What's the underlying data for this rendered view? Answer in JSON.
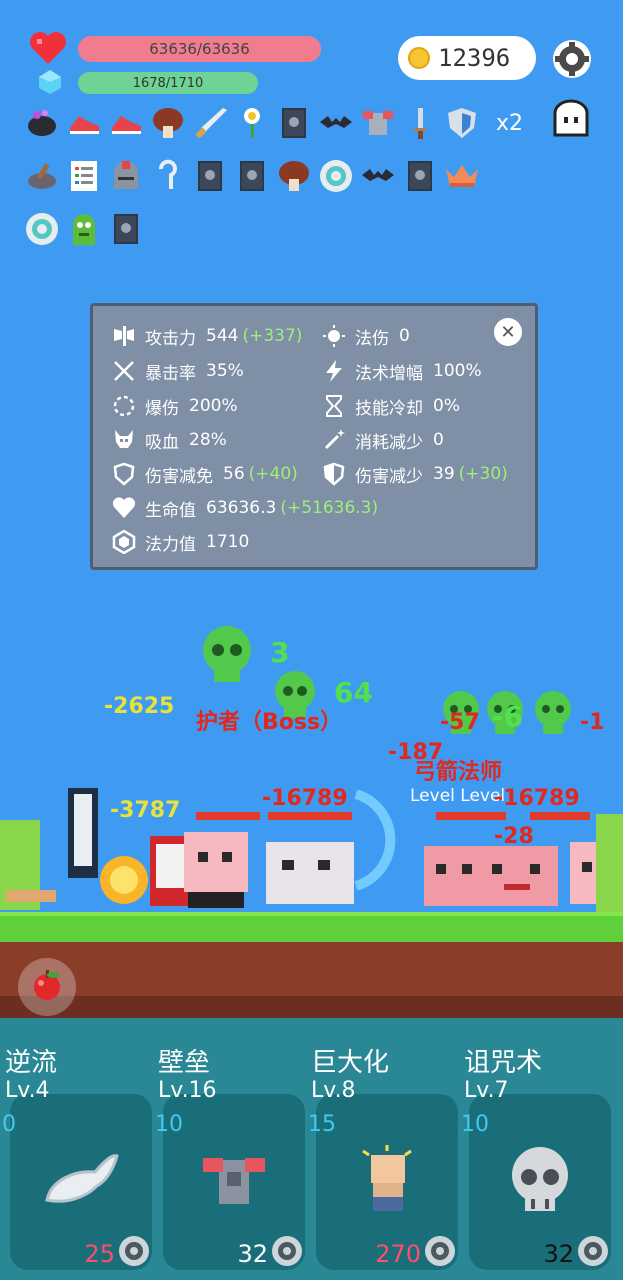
{
  "hud": {
    "hp": "63636/63636",
    "mp": "1678/1710",
    "coins": "12396",
    "multiplier": "x2"
  },
  "items": {
    "row1": [
      "cauldron-icon",
      "sneaker-icon",
      "sneaker-icon",
      "mushroom-icon",
      "sword-icon",
      "flower-icon",
      "skull-book-icon",
      "bat-icon",
      "armor-icon",
      "dagger-icon",
      "shield-icon"
    ],
    "row2": [
      "mortar-icon",
      "scroll-list-icon",
      "knight-helmet-icon",
      "hook-icon",
      "skull-book-icon",
      "skull-book-icon",
      "mushroom-icon",
      "ring-icon",
      "bat-icon",
      "skull-book-icon",
      "crown-icon"
    ],
    "row3": [
      "ring-icon",
      "green-monster-icon",
      "skull-book-icon"
    ]
  },
  "stats": {
    "attack": {
      "label": "攻击力",
      "value": "544",
      "bonus": "(+337)"
    },
    "magic_damage": {
      "label": "法伤",
      "value": "0"
    },
    "crit_rate": {
      "label": "暴击率",
      "value": "35%"
    },
    "spell_amp": {
      "label": "法术增幅",
      "value": "100%"
    },
    "crit_damage": {
      "label": "爆伤",
      "value": "200%"
    },
    "cooldown": {
      "label": "技能冷却",
      "value": "0%"
    },
    "lifesteal": {
      "label": "吸血",
      "value": "28%"
    },
    "cost_reduction": {
      "label": "消耗减少",
      "value": "0"
    },
    "dmg_reduction_pct": {
      "label": "伤害减免",
      "value": "56",
      "bonus": "(+40)"
    },
    "dmg_reduction_flat": {
      "label": "伤害减少",
      "value": "39",
      "bonus": "(+30)"
    },
    "health": {
      "label": "生命值",
      "value": "63636.3",
      "bonus": "(+51636.3)"
    },
    "mana": {
      "label": "法力值",
      "value": "1710"
    }
  },
  "battle": {
    "boss_label": "护者（Boss）",
    "level_label": "Level Level",
    "enemy_name": "弓箭法师",
    "damage_numbers": [
      "-2625",
      "-57",
      "-16789",
      "-28",
      "-3787",
      "-187",
      "-1",
      "-6",
      "3",
      "64"
    ]
  },
  "skills": [
    {
      "name": "逆流",
      "level": "Lv.4",
      "cost": "0",
      "count": "25",
      "count_color": "#ff4d6a",
      "icon": "wing-icon"
    },
    {
      "name": "壁垒",
      "level": "Lv.16",
      "cost": "10",
      "count": "32",
      "count_color": "#ffffff",
      "icon": "armor-icon"
    },
    {
      "name": "巨大化",
      "level": "Lv.8",
      "cost": "15",
      "count": "270",
      "count_color": "#ff4d6a",
      "icon": "fist-icon"
    },
    {
      "name": "诅咒术",
      "level": "Lv.7",
      "cost": "10",
      "count": "32",
      "count_color": "#111111",
      "icon": "skull-icon"
    }
  ]
}
